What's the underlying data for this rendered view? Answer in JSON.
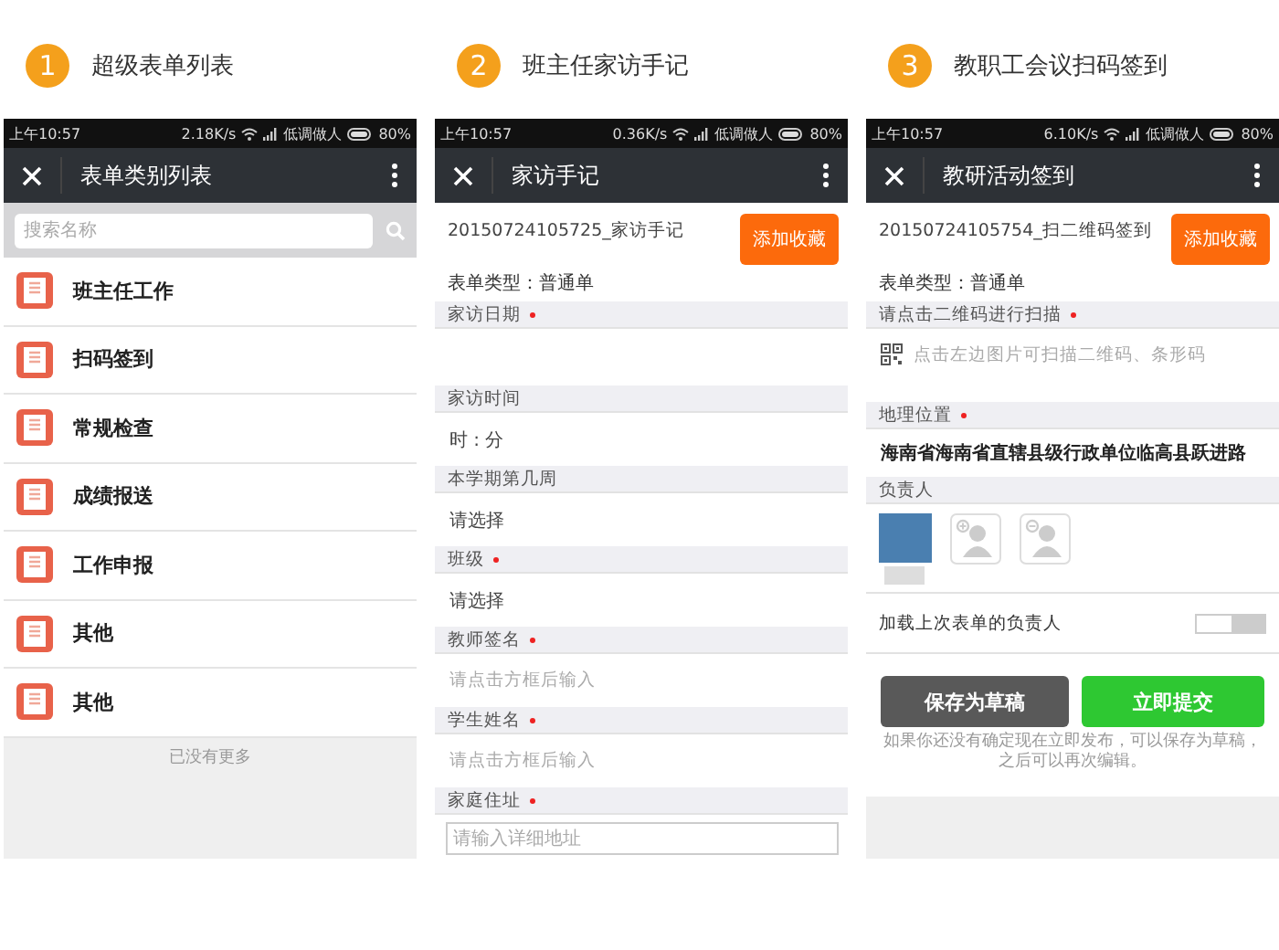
{
  "panels": [
    {
      "number": "1",
      "caption": "超级表单列表",
      "kind": "list",
      "status": {
        "time": "上午10:57",
        "speed": "2.18K/s",
        "carrier": "低调做人",
        "battery": "80%"
      },
      "title": "表单类别列表",
      "search": {
        "placeholder": "搜索名称"
      },
      "items": [
        "班主任工作",
        "扫码签到",
        "常规检查",
        "成绩报送",
        "工作申报",
        "其他",
        "其他"
      ],
      "footer": "已没有更多"
    },
    {
      "number": "2",
      "caption": "班主任家访手记",
      "kind": "form",
      "status": {
        "time": "上午10:57",
        "speed": "0.36K/s",
        "carrier": "低调做人",
        "battery": "80%"
      },
      "title": "家访手记",
      "record_title": "20150724105725_家访手记",
      "favorite_button": "添加收藏",
      "form_type": "表单类型：普通单",
      "fields": [
        {
          "label": "家访日期",
          "required": true,
          "kind": "blank"
        },
        {
          "label": "家访时间",
          "required": false,
          "kind": "value",
          "value": "时 : 分"
        },
        {
          "label": "本学期第几周",
          "required": false,
          "kind": "value",
          "value": "请选择"
        },
        {
          "label": "班级",
          "required": true,
          "kind": "value",
          "value": "请选择"
        },
        {
          "label": "教师签名",
          "required": true,
          "kind": "hint",
          "placeholder": "请点击方框后输入"
        },
        {
          "label": "学生姓名",
          "required": true,
          "kind": "hint",
          "placeholder": "请点击方框后输入"
        },
        {
          "label": "家庭住址",
          "required": true,
          "kind": "textarea",
          "placeholder": "请输入详细地址"
        }
      ]
    },
    {
      "number": "3",
      "caption": "教职工会议扫码签到",
      "kind": "form",
      "status": {
        "time": "上午10:57",
        "speed": "6.10K/s",
        "carrier": "低调做人",
        "battery": "80%"
      },
      "title": "教研活动签到",
      "record_title": "20150724105754_扫二维码签到",
      "favorite_button": "添加收藏",
      "form_type": "表单类型：普通单",
      "fields": [
        {
          "label": "请点击二维码进行扫描",
          "required": true,
          "kind": "scan",
          "placeholder": "点击左边图片可扫描二维码、条形码"
        },
        {
          "label": "地理位置",
          "required": true,
          "kind": "location",
          "value": "海南省海南省直辖县级行政单位临高县跃进路"
        },
        {
          "label": "负责人",
          "required": false,
          "kind": "people",
          "people": [
            {
              "kind": "photo"
            },
            {
              "kind": "add"
            },
            {
              "kind": "remove"
            }
          ]
        }
      ],
      "toggle": {
        "label": "加载上次表单的负责人",
        "on": false
      },
      "buttons": [
        {
          "label": "保存为草稿",
          "kind": "draft"
        },
        {
          "label": "立即提交",
          "kind": "submit"
        }
      ],
      "note": "如果你还没有确定现在立即发布，可以保存为草稿，之后可以再次编辑。"
    }
  ]
}
